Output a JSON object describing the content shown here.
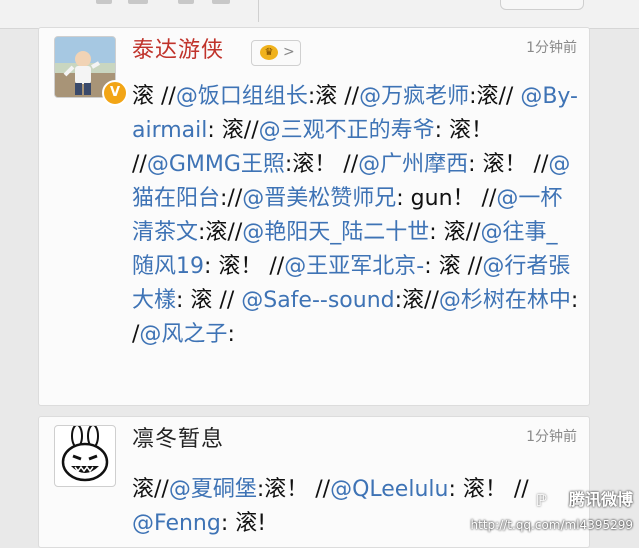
{
  "feed": {
    "posts": [
      {
        "author": "泰达游侠",
        "vip_chevron": ">",
        "verified_badge": "V",
        "time": "1分钟前",
        "segments": [
          {
            "t": "滚 //",
            "mention": false
          },
          {
            "t": "@饭口组组长",
            "mention": true
          },
          {
            "t": ":滚 //",
            "mention": false
          },
          {
            "t": "@万疯老师",
            "mention": true
          },
          {
            "t": ":滚// ",
            "mention": false
          },
          {
            "t": "@By-airmail",
            "mention": true
          },
          {
            "t": ": 滚//",
            "mention": false
          },
          {
            "t": "@三观不正的寿爷",
            "mention": true
          },
          {
            "t": ": 滚！ //",
            "mention": false
          },
          {
            "t": "@GMMG王照",
            "mention": true
          },
          {
            "t": ":滚！ //",
            "mention": false
          },
          {
            "t": "@广州摩西",
            "mention": true
          },
          {
            "t": ": 滚！ //",
            "mention": false
          },
          {
            "t": "@猫在阳台",
            "mention": true
          },
          {
            "t": "://",
            "mention": false
          },
          {
            "t": "@晋美松赞师兄",
            "mention": true
          },
          {
            "t": ": gun！ //",
            "mention": false
          },
          {
            "t": "@一杯清茶文",
            "mention": true
          },
          {
            "t": ":滚//",
            "mention": false
          },
          {
            "t": "@艳阳天_陆二十世",
            "mention": true
          },
          {
            "t": ": 滚//",
            "mention": false
          },
          {
            "t": "@往事_随风19",
            "mention": true
          },
          {
            "t": ": 滚！ //",
            "mention": false
          },
          {
            "t": "@王亚军北京-",
            "mention": true
          },
          {
            "t": ": 滚 //",
            "mention": false
          },
          {
            "t": "@行者張大樣",
            "mention": true
          },
          {
            "t": ": 滚 // ",
            "mention": false
          },
          {
            "t": "@Safe--sound",
            "mention": true
          },
          {
            "t": ":滚//",
            "mention": false
          },
          {
            "t": "@杉树在林中",
            "mention": true
          },
          {
            "t": ": /",
            "mention": false
          },
          {
            "t": "@风之子",
            "mention": true
          },
          {
            "t": ":",
            "mention": false
          }
        ]
      },
      {
        "author": "凛冬暂息",
        "time": "1分钟前",
        "segments": [
          {
            "t": "滚//",
            "mention": false
          },
          {
            "t": "@夏硐堡",
            "mention": true
          },
          {
            "t": ":滚！ //",
            "mention": false
          },
          {
            "t": "@QLeelulu",
            "mention": true
          },
          {
            "t": ": 滚！ // ",
            "mention": false
          },
          {
            "t": "@Fenng",
            "mention": true
          },
          {
            "t": ": 滚!",
            "mention": false
          }
        ]
      }
    ]
  },
  "watermark": {
    "brand": "腾讯微博",
    "url": "http://t.qq.com/ml4395299"
  },
  "colors": {
    "author_highlight": "#c0332b",
    "mention": "#3e73b5",
    "time": "#8a8a8a"
  },
  "icons": {
    "vip": "crown-icon",
    "verified": "verified-v-icon",
    "brand": "tencent-weibo-icon"
  }
}
